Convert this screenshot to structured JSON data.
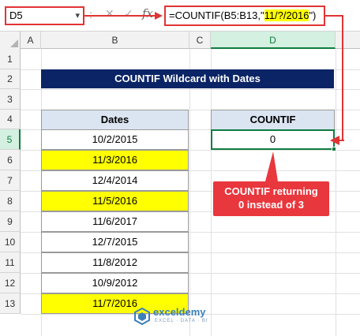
{
  "formula_bar": {
    "name_box": "D5",
    "separator": ":",
    "cancel_glyph": "✕",
    "enter_glyph": "✓",
    "fx_label": "fx",
    "formula_prefix": "=COUNTIF(B5:B13,\"",
    "formula_highlight": "11/?/2016",
    "formula_suffix": "\")"
  },
  "columns": [
    "A",
    "B",
    "C",
    "D"
  ],
  "rows": [
    "1",
    "2",
    "3",
    "4",
    "5",
    "6",
    "7",
    "8",
    "9",
    "10",
    "11",
    "12",
    "13"
  ],
  "selected_column": "D",
  "selected_row": "5",
  "title": "COUNTIF Wildcard with Dates",
  "dates_table": {
    "header": "Dates",
    "values": [
      "10/2/2015",
      "11/3/2016",
      "12/4/2014",
      "11/5/2016",
      "11/6/2017",
      "12/7/2015",
      "11/8/2012",
      "10/9/2012",
      "11/7/2016"
    ],
    "highlighted": [
      false,
      true,
      false,
      true,
      false,
      false,
      false,
      false,
      true
    ]
  },
  "countif_table": {
    "header": "COUNTIF",
    "value": "0"
  },
  "callout": {
    "line1": "COUNTIF returning",
    "line2": "0 instead of 3"
  },
  "logo": {
    "name": "exceldemy",
    "tagline": "EXCEL · DATA · BI"
  },
  "colors": {
    "highlight": "#ffff00",
    "title_bg": "#0b2466",
    "annotation_red": "#e8373d",
    "selection_green": "#107c41",
    "header_fill": "#dbe5f1"
  }
}
